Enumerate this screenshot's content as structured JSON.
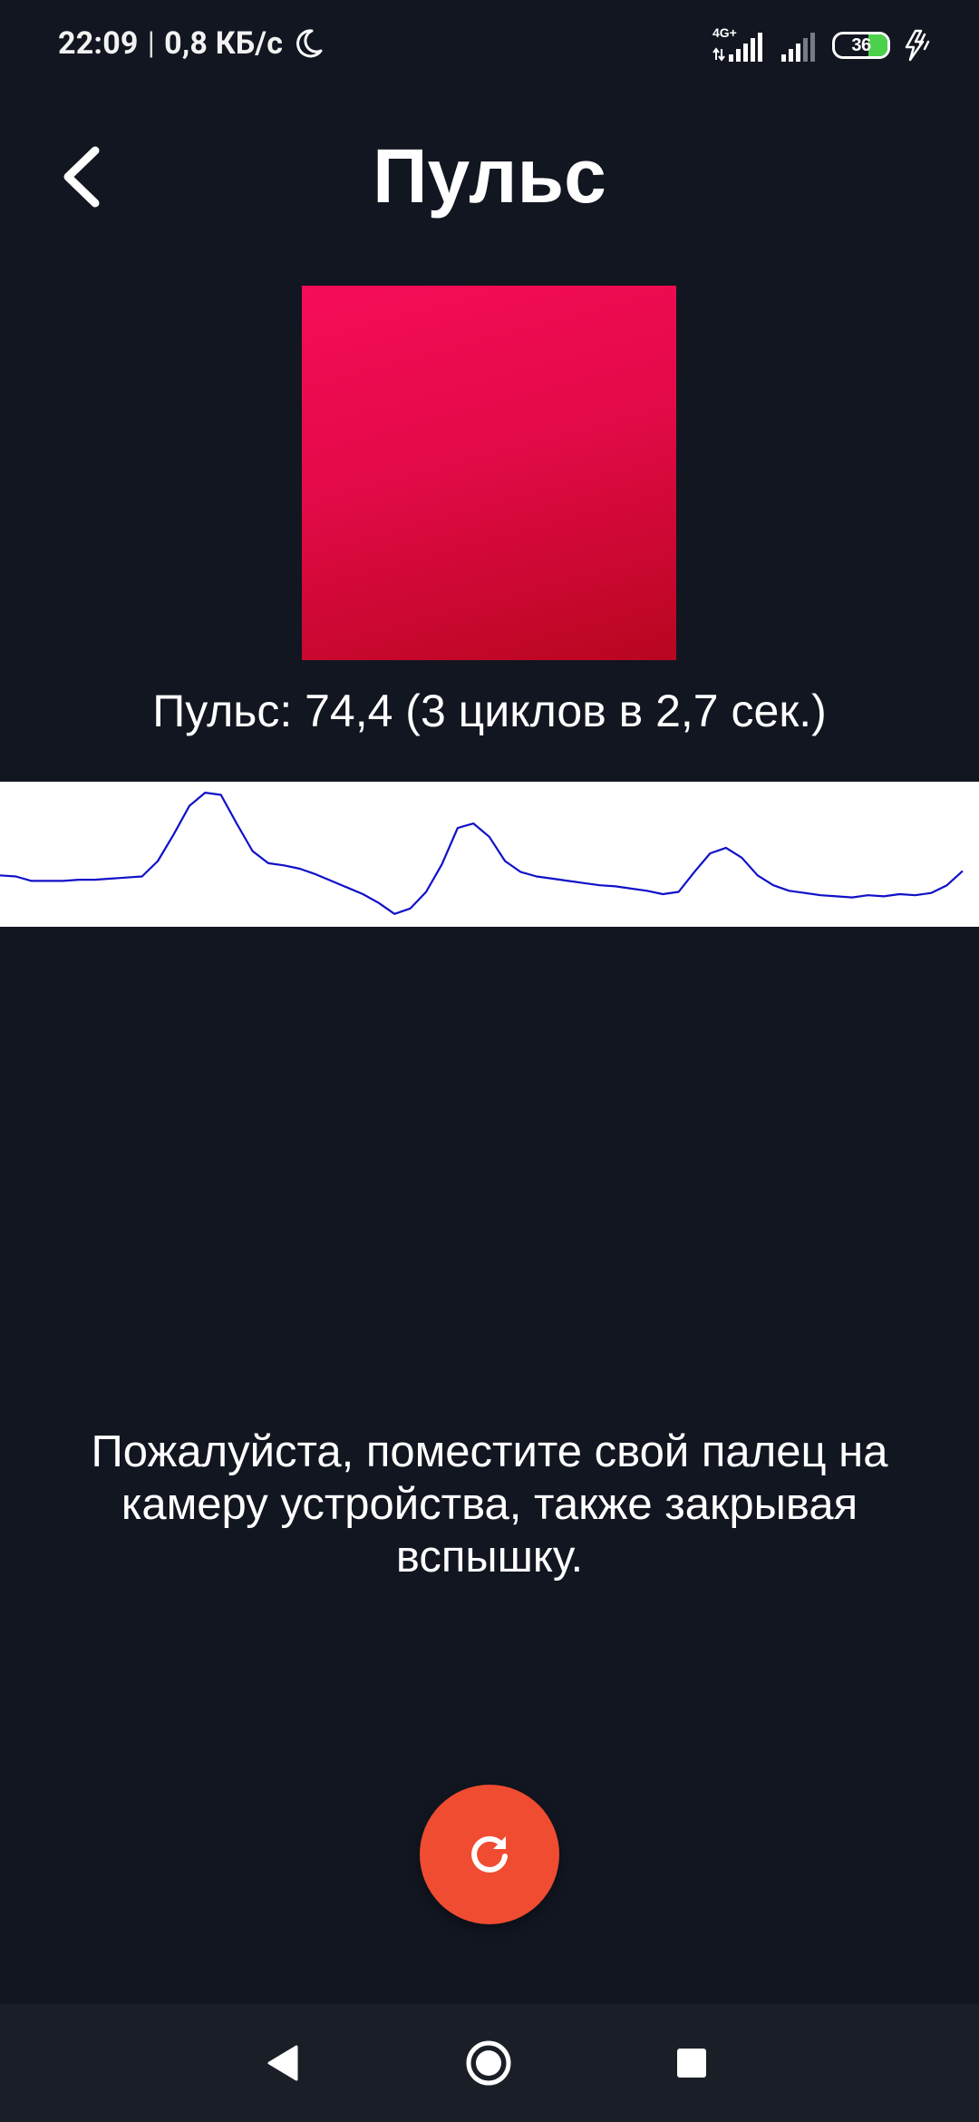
{
  "status_bar": {
    "time": "22:09",
    "separator": "|",
    "network_speed": "0,8 КБ/с",
    "network_type": "4G+",
    "battery_level": "36",
    "battery_fraction": 0.36,
    "moon_icon": "do-not-disturb-moon-icon",
    "charging_icon": "charging-bolt-icon"
  },
  "header": {
    "title": "Пульс",
    "back_icon": "chevron-left-icon"
  },
  "camera": {
    "gradient_colors": [
      "#f60c58",
      "#e30a48",
      "#b8061f"
    ]
  },
  "pulse": {
    "text": "Пульс: 74,4 (3 циклов в 2,7 сек.)"
  },
  "graph": {
    "line_color": "#1010c8",
    "background": "#ffffff",
    "samples": [
      45,
      44,
      40,
      40,
      40,
      41,
      41,
      42,
      43,
      44,
      58,
      82,
      108,
      120,
      118,
      92,
      67,
      56,
      54,
      51,
      46,
      40,
      34,
      28,
      20,
      10,
      15,
      30,
      55,
      88,
      92,
      80,
      58,
      48,
      44,
      42,
      40,
      38,
      36,
      35,
      33,
      31,
      28,
      30,
      48,
      65,
      70,
      61,
      45,
      36,
      31,
      29,
      27,
      26,
      25,
      27,
      26,
      28,
      27,
      29,
      36,
      49
    ]
  },
  "instruction": {
    "text": "Пожалуйста, поместите свой палец на камеру устройства, также закрывая вспышку."
  },
  "restart_button": {
    "icon": "refresh-icon",
    "color": "#ef4c31"
  },
  "nav_bar": {
    "back_icon": "nav-back-triangle-icon",
    "home_icon": "nav-home-circle-icon",
    "recents_icon": "nav-recents-square-icon"
  }
}
